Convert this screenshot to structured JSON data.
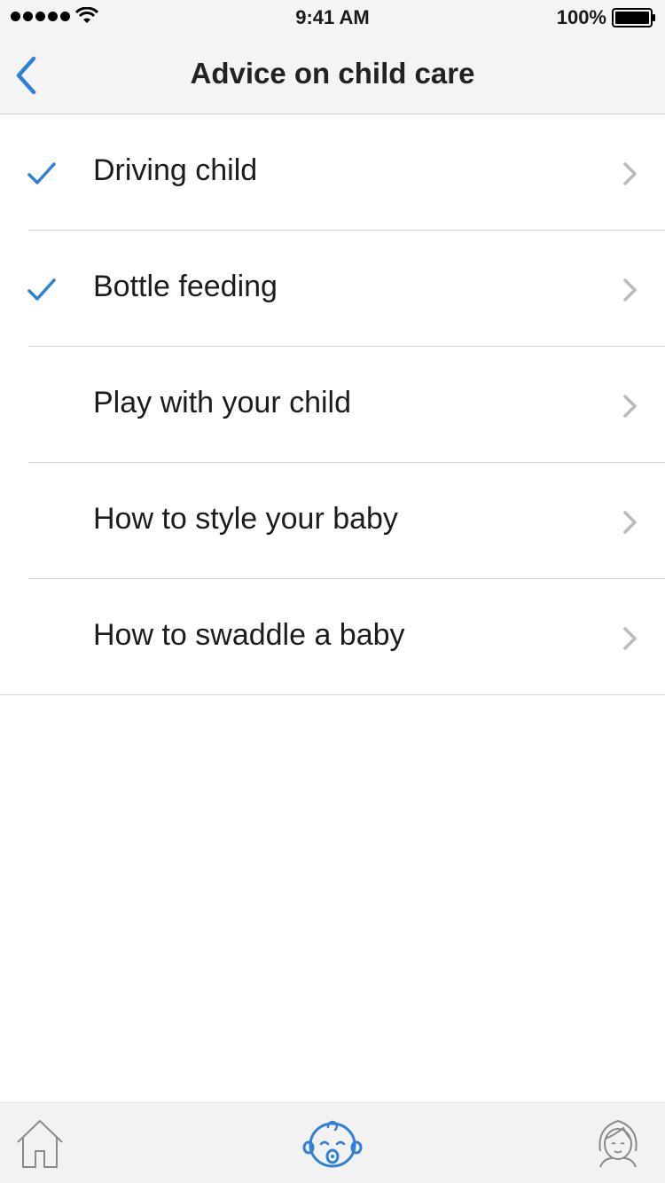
{
  "status_bar": {
    "time": "9:41 AM",
    "battery": "100%"
  },
  "nav": {
    "title": "Advice on child care",
    "back_icon": "chevron-left-icon"
  },
  "colors": {
    "accent": "#2f80d8",
    "chevron": "#b9b9c0",
    "divider": "#d4d4d4",
    "bar_bg": "#f4f4f4"
  },
  "items": [
    {
      "label": "Driving child",
      "checked": true
    },
    {
      "label": "Bottle feeding",
      "checked": true
    },
    {
      "label": "Play with your child",
      "checked": false
    },
    {
      "label": "How to style your baby",
      "checked": false
    },
    {
      "label": "How to swaddle a baby",
      "checked": false
    }
  ],
  "tabs": [
    {
      "name": "home",
      "icon": "home-icon",
      "active": false
    },
    {
      "name": "baby",
      "icon": "baby-face-icon",
      "active": true
    },
    {
      "name": "mother",
      "icon": "mother-face-icon",
      "active": false
    }
  ]
}
